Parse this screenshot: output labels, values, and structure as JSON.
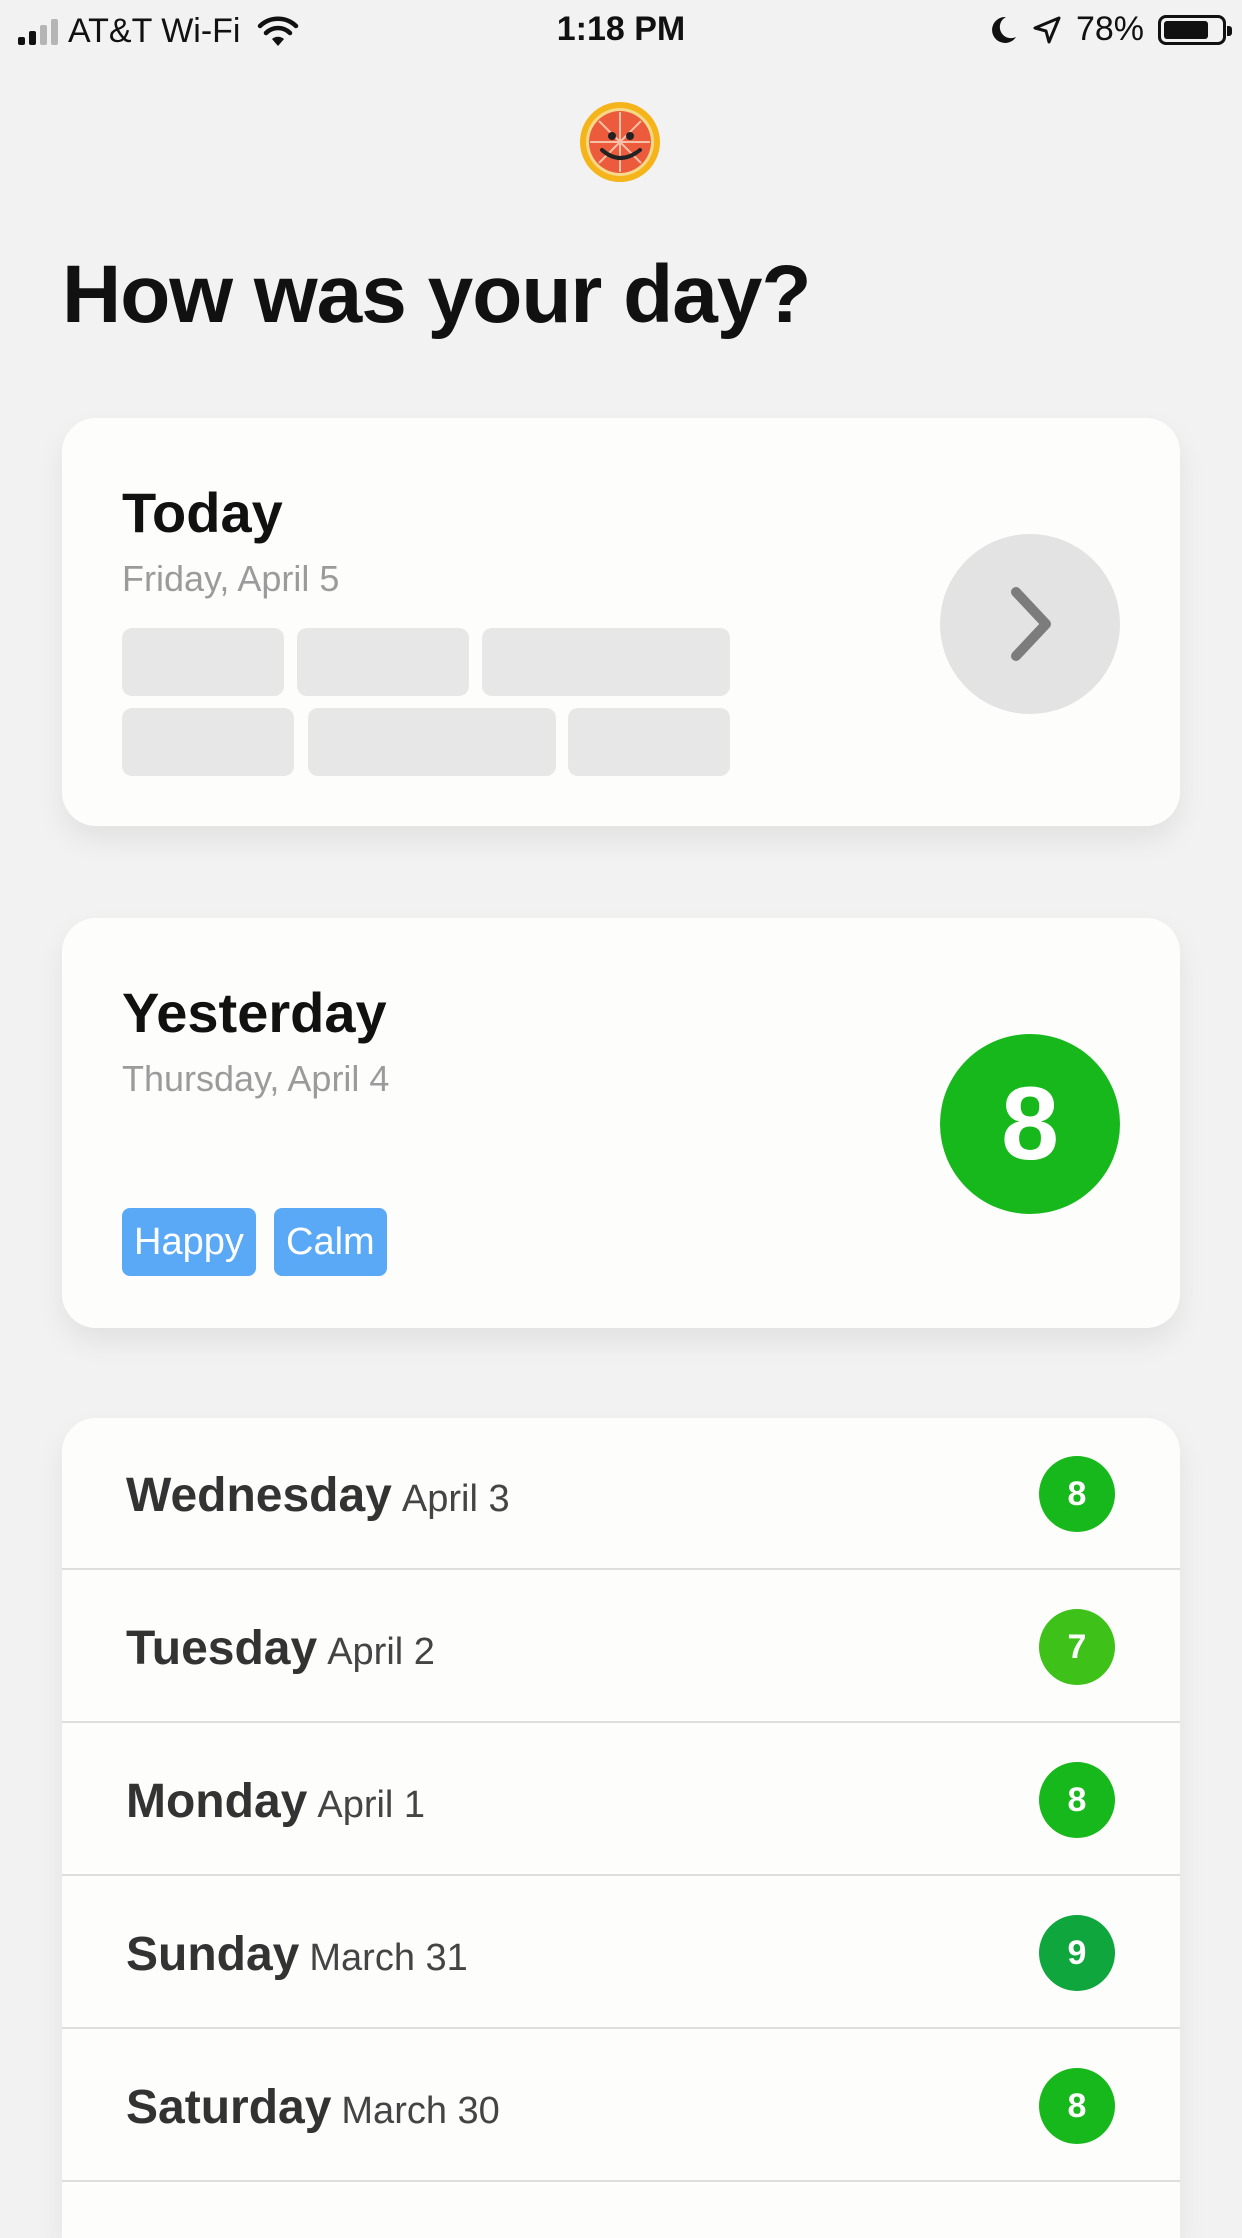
{
  "status_bar": {
    "carrier": "AT&T Wi-Fi",
    "time": "1:18 PM",
    "battery": "78%",
    "battery_level": 0.78,
    "icons": [
      "signal-icon",
      "wifi-icon",
      "moon-icon",
      "location-arrow-icon",
      "battery-icon"
    ]
  },
  "header": {
    "logo_icon": "grapefruit-smile-logo-icon",
    "title": "How was your day?"
  },
  "today": {
    "title": "Today",
    "date": "Friday, April 5",
    "action_icon": "chevron-right-icon"
  },
  "yesterday": {
    "title": "Yesterday",
    "date": "Thursday, April 4",
    "score": "8",
    "score_color": "#17b81b",
    "tags": [
      "Happy",
      "Calm"
    ],
    "tag_color": "#5aa9f7"
  },
  "history": [
    {
      "day": "Wednesday",
      "date": "April 3",
      "score": "8",
      "color": "#17b81b"
    },
    {
      "day": "Tuesday",
      "date": "April 2",
      "score": "7",
      "color": "#3ec21a"
    },
    {
      "day": "Monday",
      "date": "April 1",
      "score": "8",
      "color": "#17b81b"
    },
    {
      "day": "Sunday",
      "date": "March 31",
      "score": "9",
      "color": "#0fa63d"
    },
    {
      "day": "Saturday",
      "date": "March 30",
      "score": "8",
      "color": "#17b81b"
    }
  ]
}
